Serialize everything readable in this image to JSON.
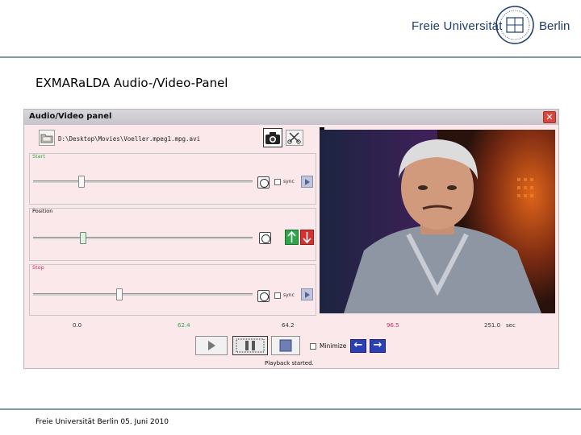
{
  "slide": {
    "title": "EXMARaLDA Audio-/Video-Panel",
    "footer": "Freie Universität Berlin 05. Juni 2010",
    "logo_left": "Freie Universität",
    "logo_right": "Berlin"
  },
  "window": {
    "title": "Audio/Video panel",
    "close_glyph": "✕",
    "file_path": "D:\\Desktop\\Movies\\Voeller.mpeg1.mpg.avi",
    "sections": {
      "start": {
        "label": "Start",
        "color": "#2ea84a",
        "sync_label": "sync",
        "thumb_fraction": 0.21
      },
      "position": {
        "label": "Position",
        "color": "#111111",
        "thumb_fraction": 0.22
      },
      "stop": {
        "label": "Stop",
        "color": "#cc2f5b",
        "sync_label": "sync",
        "thumb_fraction": 0.39
      }
    },
    "timeline": {
      "t0": "0.0",
      "t_start": "62.4",
      "t_mid": "64.2",
      "t_stop": "96.5",
      "t_end": "251.0",
      "unit": "sec",
      "start_color": "#2ea84a",
      "stop_color": "#cc2f5b"
    },
    "playback": {
      "minimize_label": "Minimize",
      "status": "Playback started."
    },
    "icons": {
      "open": "folder-open-icon",
      "snapshot": "camera-icon",
      "cut": "scissors-icon",
      "back": "arrow-left-icon",
      "forward": "arrow-right-icon"
    }
  }
}
